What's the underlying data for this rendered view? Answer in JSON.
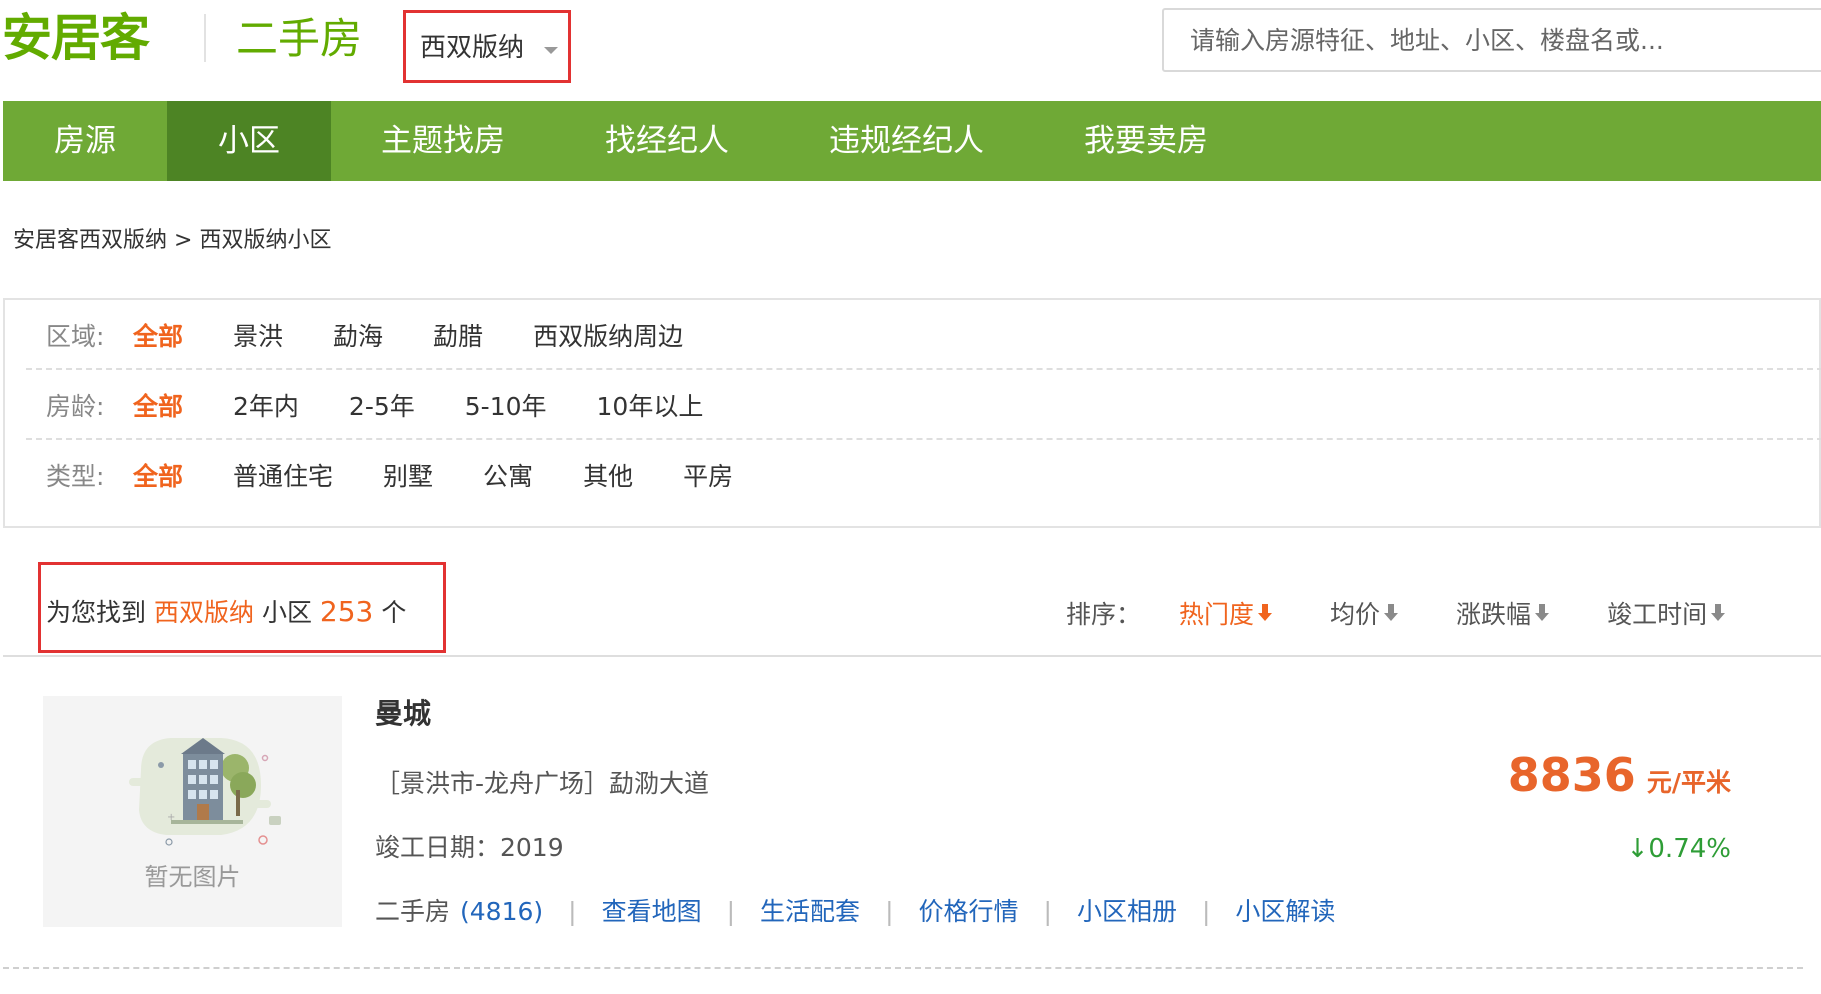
{
  "header": {
    "logo": "安居客",
    "section": "二手房",
    "city": "西双版纳",
    "search_placeholder": "请输入房源特征、地址、小区、楼盘名或..."
  },
  "nav": {
    "items": [
      "房源",
      "小区",
      "主题找房",
      "找经纪人",
      "违规经纪人",
      "我要卖房"
    ],
    "active": "小区"
  },
  "breadcrumb": {
    "home": "安居客西双版纳",
    "separator": ">",
    "current": "西双版纳小区"
  },
  "filters": {
    "region": {
      "label": "区域:",
      "options": [
        "全部",
        "景洪",
        "勐海",
        "勐腊",
        "西双版纳周边"
      ]
    },
    "age": {
      "label": "房龄:",
      "options": [
        "全部",
        "2年内",
        "2-5年",
        "5-10年",
        "10年以上"
      ]
    },
    "type": {
      "label": "类型:",
      "options": [
        "全部",
        "普通住宅",
        "别墅",
        "公寓",
        "其他",
        "平房"
      ]
    }
  },
  "summary": {
    "prefix": "为您找到",
    "city": "西双版纳",
    "mid": "小区",
    "count": "253",
    "suffix": "个"
  },
  "sort": {
    "label": "排序：",
    "options": [
      "热门度",
      "均价",
      "涨跌幅",
      "竣工时间"
    ]
  },
  "listing": {
    "no_image": "暂无图片",
    "title": "曼城",
    "address": "［景洪市-龙舟广场］勐泐大道",
    "year": "竣工日期：2019",
    "links": {
      "second_hand_label": "二手房",
      "second_hand_count": "(4816)",
      "map": "查看地图",
      "life": "生活配套",
      "price_trend": "价格行情",
      "album": "小区相册",
      "interpret": "小区解读"
    },
    "price": "8836",
    "price_unit": "元/平米",
    "change": "↓0.74%"
  },
  "colors": {
    "brand_green": "#62ab00",
    "nav_green": "#6fa936",
    "nav_active": "#4d8424",
    "accent_orange": "#f0641e",
    "highlight_red": "#e23232",
    "link_blue": "#2266bb",
    "down_green": "#2e9d36"
  }
}
